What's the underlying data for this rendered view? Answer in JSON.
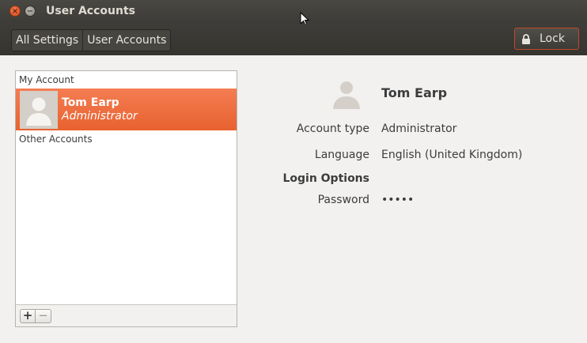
{
  "window": {
    "title": "User Accounts"
  },
  "titlebar": {
    "close_glyph": "×",
    "minimize_glyph": "−"
  },
  "toolbar": {
    "breadcrumbs": [
      "All Settings",
      "User Accounts"
    ],
    "lock_label": "Lock",
    "lock_icon": "lock-icon"
  },
  "accounts_list": {
    "my_account_header": "My Account",
    "selected_user": {
      "name": "Tom Earp",
      "role": "Administrator"
    },
    "other_accounts_header": "Other Accounts",
    "add_label": "+",
    "remove_label": "−"
  },
  "details": {
    "user_name": "Tom Earp",
    "account_type_label": "Account type",
    "account_type_value": "Administrator",
    "language_label": "Language",
    "language_value": "English (United Kingdom)",
    "login_options_label": "Login Options",
    "password_label": "Password",
    "password_value": "•••••"
  },
  "colors": {
    "accent": "#e8622f",
    "titlebar": "#3c3b37",
    "background": "#f2f1f0"
  }
}
